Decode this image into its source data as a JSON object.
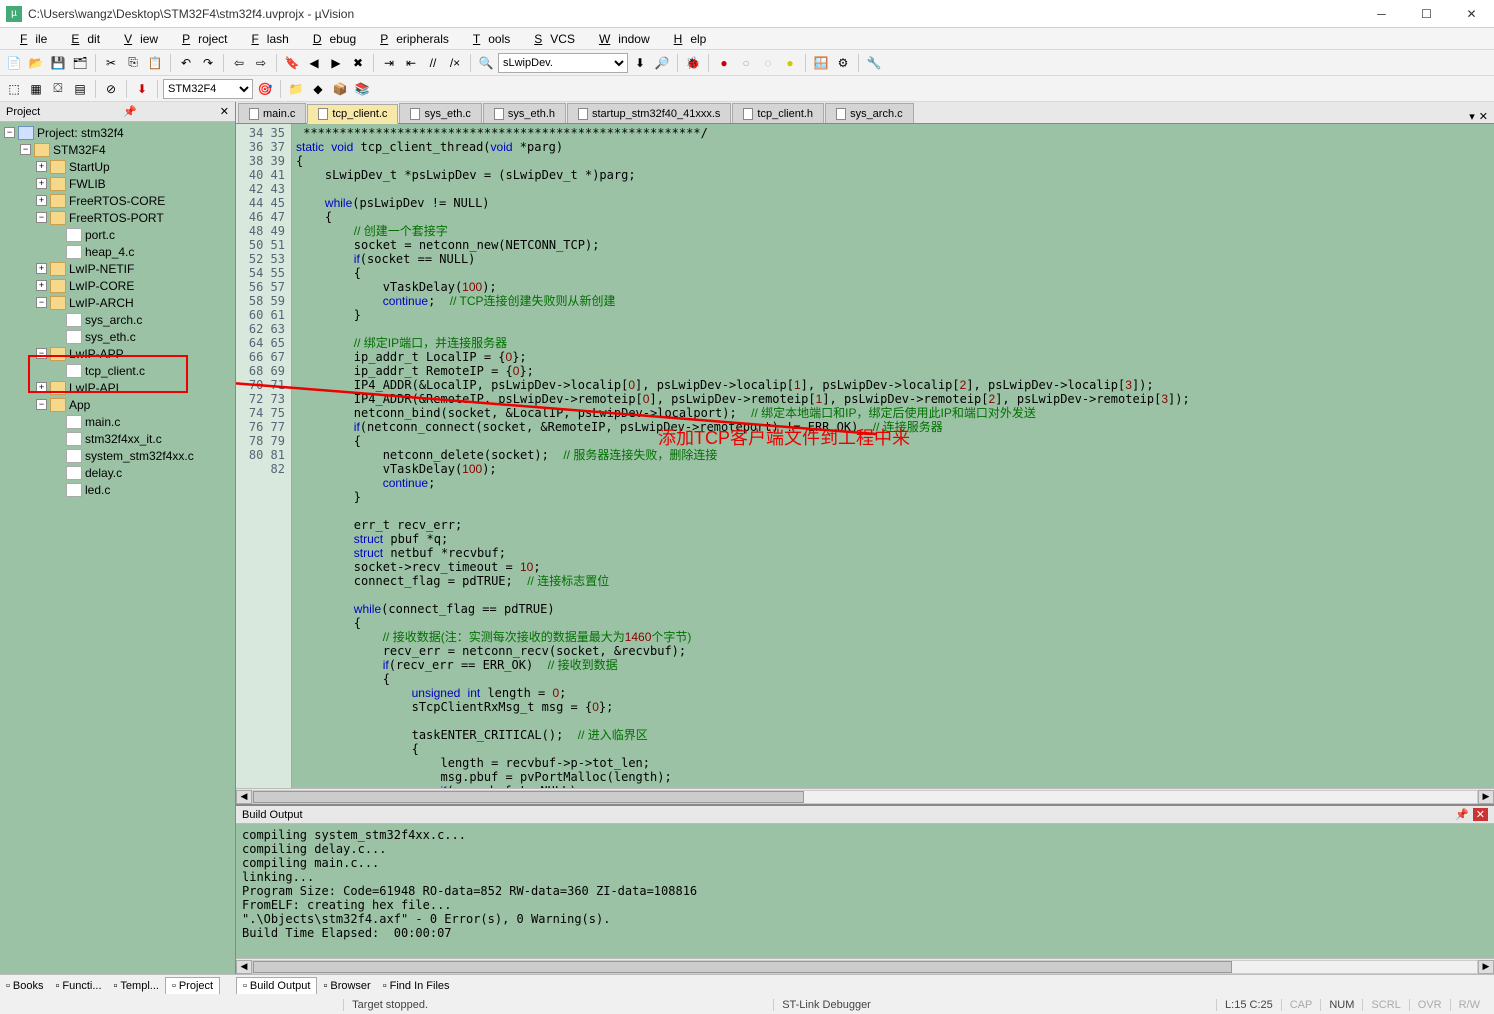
{
  "window": {
    "title": "C:\\Users\\wangz\\Desktop\\STM32F4\\stm32f4.uvprojx - µVision"
  },
  "menu": [
    "File",
    "Edit",
    "View",
    "Project",
    "Flash",
    "Debug",
    "Peripherals",
    "Tools",
    "SVCS",
    "Window",
    "Help"
  ],
  "toolbar1_combo": "sLwipDev.",
  "toolbar2_target": "STM32F4",
  "project_panel": {
    "title": "Project",
    "root": "Project: stm32f4",
    "target": "STM32F4",
    "groups": [
      {
        "name": "StartUp",
        "expanded": false
      },
      {
        "name": "FWLIB",
        "expanded": false
      },
      {
        "name": "FreeRTOS-CORE",
        "expanded": false
      },
      {
        "name": "FreeRTOS-PORT",
        "expanded": true,
        "files": [
          "port.c",
          "heap_4.c"
        ]
      },
      {
        "name": "LwIP-NETIF",
        "expanded": false
      },
      {
        "name": "LwIP-CORE",
        "expanded": false
      },
      {
        "name": "LwIP-ARCH",
        "expanded": true,
        "files": [
          "sys_arch.c",
          "sys_eth.c"
        ]
      },
      {
        "name": "LwIP-APP",
        "expanded": true,
        "files": [
          "tcp_client.c"
        ],
        "highlight": true
      },
      {
        "name": "LwIP-API",
        "expanded": false
      },
      {
        "name": "App",
        "expanded": true,
        "files": [
          "main.c",
          "stm32f4xx_it.c",
          "system_stm32f4xx.c",
          "delay.c",
          "led.c"
        ]
      }
    ],
    "tabs": [
      "Books",
      "Functi...",
      "Templ...",
      "Project"
    ],
    "active_tab": "Project"
  },
  "editor_tabs": [
    {
      "name": "main.c"
    },
    {
      "name": "tcp_client.c",
      "active": true
    },
    {
      "name": "sys_eth.c"
    },
    {
      "name": "sys_eth.h"
    },
    {
      "name": "startup_stm32f40_41xxx.s"
    },
    {
      "name": "tcp_client.h"
    },
    {
      "name": "sys_arch.c"
    }
  ],
  "line_start": 34,
  "line_end": 82,
  "code_lines": [
    " *******************************************************/",
    "static void tcp_client_thread(void *parg)",
    "{",
    "    sLwipDev_t *psLwipDev = (sLwipDev_t *)parg;",
    "",
    "    while(psLwipDev != NULL)",
    "    {",
    "        // 创建一个套接字",
    "        socket = netconn_new(NETCONN_TCP);",
    "        if(socket == NULL)",
    "        {",
    "            vTaskDelay(100);",
    "            continue;  // TCP连接创建失败则从新创建",
    "        }",
    "",
    "        // 绑定IP端口，并连接服务器",
    "        ip_addr_t LocalIP = {0};",
    "        ip_addr_t RemoteIP = {0};",
    "        IP4_ADDR(&LocalIP, psLwipDev->localip[0], psLwipDev->localip[1], psLwipDev->localip[2], psLwipDev->localip[3]);",
    "        IP4_ADDR(&RemoteIP, psLwipDev->remoteip[0], psLwipDev->remoteip[1], psLwipDev->remoteip[2], psLwipDev->remoteip[3]);",
    "        netconn_bind(socket, &LocalIP, psLwipDev->localport);  // 绑定本地端口和IP，绑定后使用此IP和端口对外发送",
    "        if(netconn_connect(socket, &RemoteIP, psLwipDev->remoteport) != ERR_OK)  // 连接服务器",
    "        {",
    "            netconn_delete(socket);  // 服务器连接失败，删除连接",
    "            vTaskDelay(100);",
    "            continue;",
    "        }",
    "",
    "        err_t recv_err;",
    "        struct pbuf *q;",
    "        struct netbuf *recvbuf;",
    "        socket->recv_timeout = 10;",
    "        connect_flag = pdTRUE;  // 连接标志置位",
    "",
    "        while(connect_flag == pdTRUE)",
    "        {",
    "            // 接收数据(注：实测每次接收的数据量最大为1460个字节)",
    "            recv_err = netconn_recv(socket, &recvbuf);",
    "            if(recv_err == ERR_OK)  // 接收到数据",
    "            {",
    "                unsigned int length = 0;",
    "                sTcpClientRxMsg_t msg = {0};",
    "",
    "                taskENTER_CRITICAL();  // 进入临界区",
    "                {",
    "                    length = recvbuf->p->tot_len;",
    "                    msg.pbuf = pvPortMalloc(length);",
    "                    if(msg.pbuf != NULL)",
    "                    {"
  ],
  "annotation_text": "添加TCP客户端文件到工程中来",
  "build_output": {
    "title": "Build Output",
    "lines": [
      "compiling system_stm32f4xx.c...",
      "compiling delay.c...",
      "compiling main.c...",
      "linking...",
      "Program Size: Code=61948 RO-data=852 RW-data=360 ZI-data=108816",
      "FromELF: creating hex file...",
      "\".\\Objects\\stm32f4.axf\" - 0 Error(s), 0 Warning(s).",
      "Build Time Elapsed:  00:00:07"
    ],
    "tabs": [
      "Build Output",
      "Browser",
      "Find In Files"
    ]
  },
  "status": {
    "center1": "Target stopped.",
    "center2": "ST-Link Debugger",
    "line_col": "L:15 C:25",
    "caps": "CAP",
    "num": "NUM",
    "scrl": "SCRL",
    "ovr": "OVR",
    "rw": "R/W"
  }
}
